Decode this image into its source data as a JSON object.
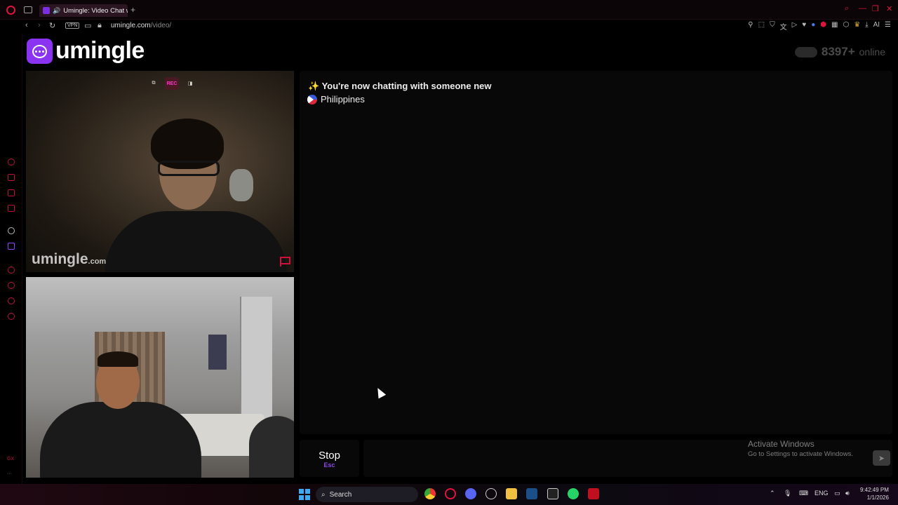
{
  "browser": {
    "tab_title": "Umingle: Video Chat w",
    "new_tab": "+",
    "vpn_label": "VPN",
    "url_host": "umingle.com",
    "url_path": "/video/",
    "ai_label": "AI",
    "ext_icons": [
      "pin-icon",
      "snapshot-icon",
      "shield-icon",
      "translate-icon",
      "play-icon",
      "heart-icon",
      "g-icon",
      "adblock-icon",
      "grid-icon",
      "puzzle-icon",
      "crown-icon",
      "download-icon",
      "ai-icon",
      "menu-icon"
    ]
  },
  "sidebar": {
    "gx_label": "GX"
  },
  "site": {
    "logo_text": "umingle",
    "online_count": "8397+",
    "online_label": "online"
  },
  "video_top": {
    "watermark": "umingle",
    "watermark_suffix": ".com",
    "record_label": "REC"
  },
  "chat": {
    "status_message": "✨ You're now chatting with someone new",
    "country": "Philippines",
    "stop_label": "Stop",
    "stop_key": "Esc",
    "send_icon": "send-icon"
  },
  "windows": {
    "activate_title": "Activate Windows",
    "activate_sub": "Go to Settings to activate Windows.",
    "search_label": "Search",
    "lang": "ENG",
    "time": "9:42:49 PM",
    "date": "1/1/2026"
  },
  "colors": {
    "accent": "#8a33f0",
    "opera_red": "#e0143c"
  }
}
